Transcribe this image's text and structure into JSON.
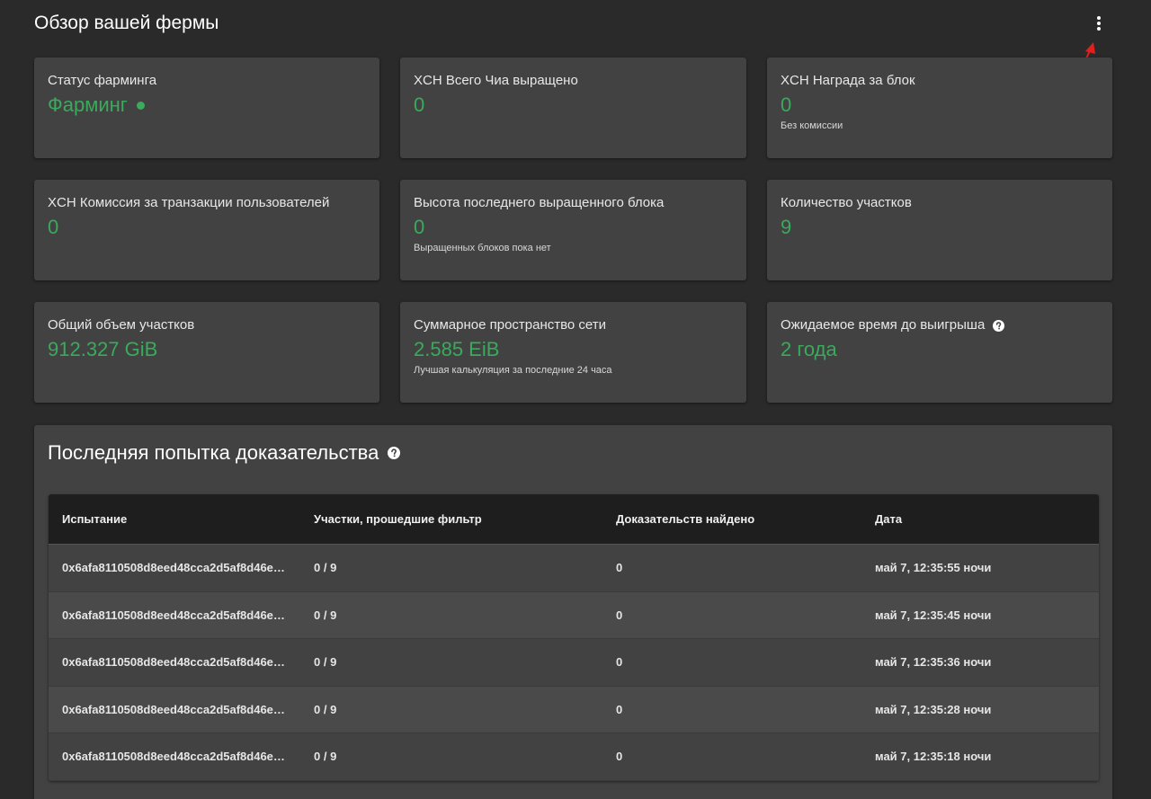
{
  "header": {
    "title": "Обзор вашей фермы",
    "menu_icon": "more-vertical-icon"
  },
  "cards": [
    {
      "title": "Статус фарминга",
      "value": "Фарминг",
      "status_icon": "status-dot-icon"
    },
    {
      "title": "XCH Всего Чиа выращено",
      "value": "0"
    },
    {
      "title": "XCH Награда за блок",
      "value": "0",
      "sub": "Без комиссии"
    },
    {
      "title": "XCH Комиссия за транзакции пользователей",
      "value": "0"
    },
    {
      "title": "Высота последнего выращенного блока",
      "value": "0",
      "sub": "Выращенных блоков пока нет"
    },
    {
      "title": "Количество участков",
      "value": "9"
    },
    {
      "title": "Общий объем участков",
      "value": "912.327 GiB"
    },
    {
      "title": "Суммарное пространство сети",
      "value": "2.585 EiB",
      "sub": "Лучшая калькуляция за последние 24 часа"
    },
    {
      "title": "Ожидаемое время до выигрыша",
      "value": "2 года",
      "help_icon": "help-circle-icon"
    }
  ],
  "proofs": {
    "title": "Последняя попытка доказательства",
    "help_icon": "help-circle-icon",
    "columns": [
      "Испытание",
      "Участки, прошедшие фильтр",
      "Доказательств найдено",
      "Дата"
    ],
    "rows": [
      [
        "0x6afa8110508d8eed48cca2d5af8d46e…",
        "0 / 9",
        "0",
        "май 7, 12:35:55 ночи"
      ],
      [
        "0x6afa8110508d8eed48cca2d5af8d46e…",
        "0 / 9",
        "0",
        "май 7, 12:35:45 ночи"
      ],
      [
        "0x6afa8110508d8eed48cca2d5af8d46e…",
        "0 / 9",
        "0",
        "май 7, 12:35:36 ночи"
      ],
      [
        "0x6afa8110508d8eed48cca2d5af8d46e…",
        "0 / 9",
        "0",
        "май 7, 12:35:28 ночи"
      ],
      [
        "0x6afa8110508d8eed48cca2d5af8d46e…",
        "0 / 9",
        "0",
        "май 7, 12:35:18 ночи"
      ]
    ]
  },
  "colors": {
    "accent_green": "#3aaa5c",
    "card_bg": "#424242",
    "page_bg": "#2a2a2a",
    "table_header_bg": "#1e1e1e",
    "arrow_red": "#e0201c"
  }
}
